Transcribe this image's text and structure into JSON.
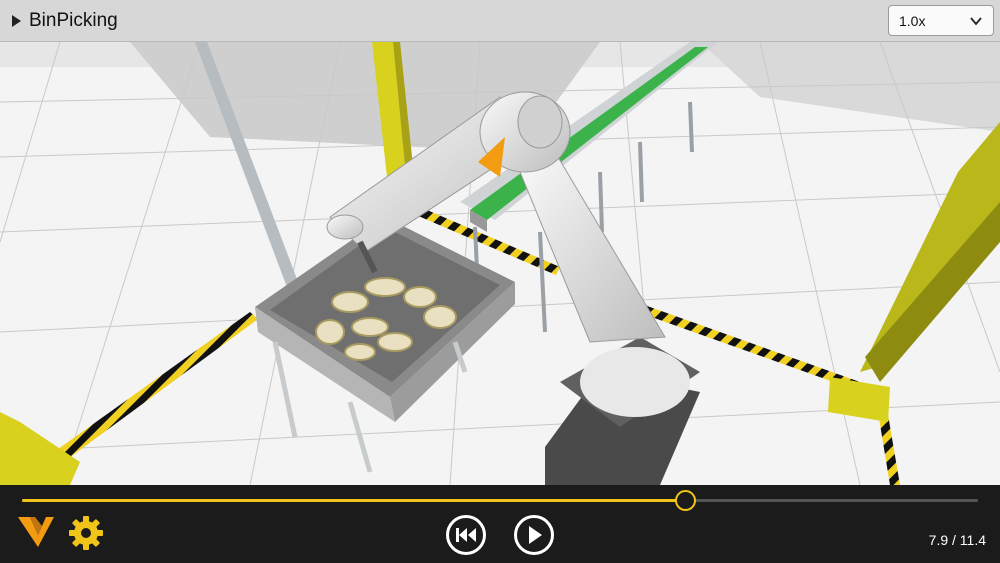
{
  "header": {
    "title": "BinPicking",
    "speed": {
      "selected": "1.0x"
    }
  },
  "playback": {
    "progress": 0.693,
    "time_display": "7.9 / 11.4"
  },
  "colors": {
    "accent": "#f0c419",
    "brand_orange": "#f39c12",
    "topbar_bg": "#d7d7d7",
    "controlbar_bg": "#1b1b1b"
  },
  "icons": {
    "expand": "triangle-right-icon",
    "speed_dropdown": "chevron-down-icon",
    "logo": "brand-v-logo",
    "settings": "gear-icon",
    "rewind": "rewind-to-start-icon",
    "play": "play-icon"
  }
}
